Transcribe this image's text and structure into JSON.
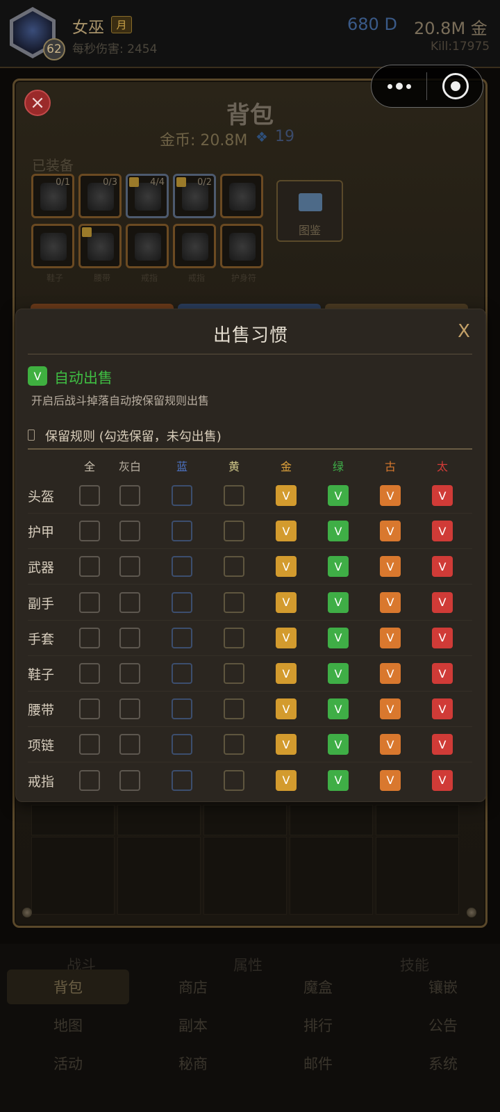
{
  "header": {
    "name": "女巫",
    "badge": "月",
    "level": "62",
    "dps": "每秒伤害: 2454",
    "diamonds": "680 D",
    "gold": "20.8M 金",
    "kills": "Kill:17975"
  },
  "backpack": {
    "title": "背包",
    "gold": "金币: 20.8M",
    "gems": "19",
    "equipped_label": "已装备",
    "codex_label": "图鉴",
    "slots_row1": [
      {
        "count": "0/1",
        "locked": false
      },
      {
        "count": "0/3",
        "locked": false
      },
      {
        "count": "4/4",
        "locked": true
      },
      {
        "count": "0/2",
        "locked": true
      },
      {
        "count": "",
        "locked": false
      }
    ],
    "slots_row2": [
      {
        "label": "鞋子",
        "locked": false
      },
      {
        "label": "腰带",
        "locked": true
      },
      {
        "label": "戒指",
        "locked": false
      },
      {
        "label": "戒指",
        "locked": false
      },
      {
        "label": "护身符",
        "locked": false
      }
    ]
  },
  "modal": {
    "title": "出售习惯",
    "close": "X",
    "auto_sell_check": "V",
    "auto_sell_label": "自动出售",
    "auto_sell_desc": "开启后战斗掉落自动按保留规则出售",
    "rule_title": "保留规则 (勾选保留，未勾出售)",
    "columns": [
      "全",
      "灰白",
      "蓝",
      "黄",
      "金",
      "绿",
      "古",
      "太"
    ],
    "column_colors": [
      "#c9bfae",
      "#b8b0a2",
      "#4d74c6",
      "#d2c98a",
      "#e0a33b",
      "#3fb049",
      "#d9792e",
      "#d23b37"
    ],
    "check_mark": "V",
    "rows": [
      {
        "label": "头盔",
        "checked": [
          false,
          false,
          false,
          false,
          true,
          true,
          true,
          true
        ]
      },
      {
        "label": "护甲",
        "checked": [
          false,
          false,
          false,
          false,
          true,
          true,
          true,
          true
        ]
      },
      {
        "label": "武器",
        "checked": [
          false,
          false,
          false,
          false,
          true,
          true,
          true,
          true
        ]
      },
      {
        "label": "副手",
        "checked": [
          false,
          false,
          false,
          false,
          true,
          true,
          true,
          true
        ]
      },
      {
        "label": "手套",
        "checked": [
          false,
          false,
          false,
          false,
          true,
          true,
          true,
          true
        ]
      },
      {
        "label": "鞋子",
        "checked": [
          false,
          false,
          false,
          false,
          true,
          true,
          true,
          true
        ]
      },
      {
        "label": "腰带",
        "checked": [
          false,
          false,
          false,
          false,
          true,
          true,
          true,
          true
        ]
      },
      {
        "label": "项链",
        "checked": [
          false,
          false,
          false,
          false,
          true,
          true,
          true,
          true
        ]
      },
      {
        "label": "戒指",
        "checked": [
          false,
          false,
          false,
          false,
          true,
          true,
          true,
          true
        ]
      }
    ]
  },
  "nav": {
    "top": [
      "战斗",
      "属性",
      "技能"
    ],
    "rows": [
      [
        "背包",
        "商店",
        "魔盒",
        "镶嵌"
      ],
      [
        "地图",
        "副本",
        "排行",
        "公告"
      ],
      [
        "活动",
        "秘商",
        "邮件",
        "系统"
      ]
    ],
    "active": "背包"
  }
}
